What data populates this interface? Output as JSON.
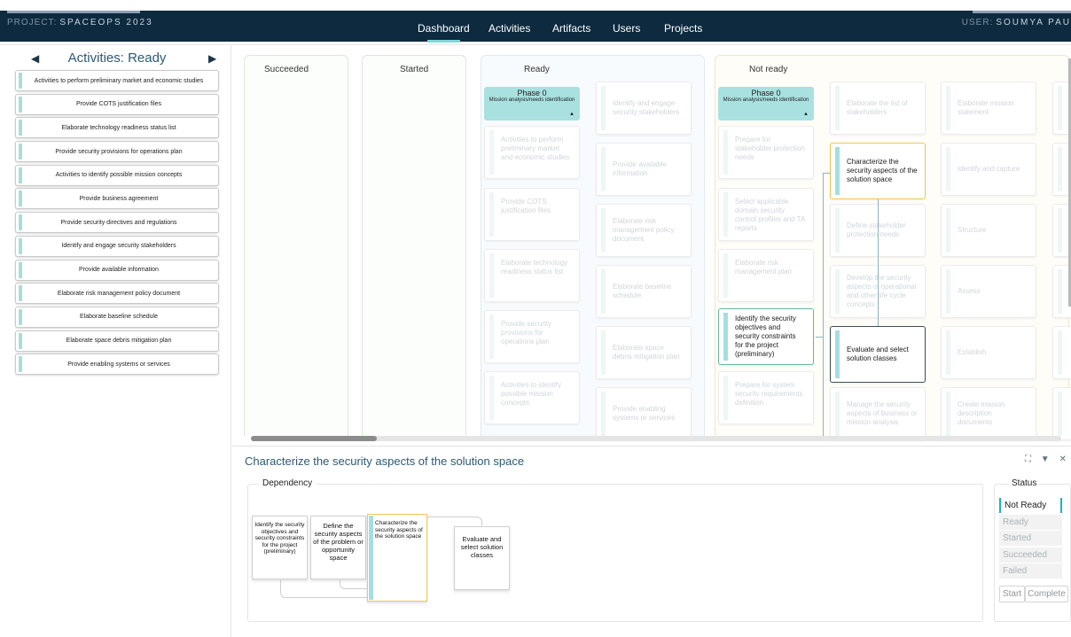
{
  "header": {
    "project_label": "PROJECT:",
    "project_name": "SPACEOPS 2023",
    "user_label": "USER:",
    "user_name": "SOUMYA PAU",
    "nav": [
      "Dashboard",
      "Activities",
      "Artifacts",
      "Users",
      "Projects"
    ]
  },
  "left_panel": {
    "title": "Activities: Ready",
    "items": [
      "Activities to perform preliminary market and economic studies",
      "Provide COTS justification files",
      "Elaborate technology readiness status list",
      "Provide security provisions for operations plan",
      "Activities to identify possible mission concepts",
      "Provide business agreement",
      "Provide security directives and regulations",
      "Identify and engage security stakeholders",
      "Provide available information",
      "Elaborate risk management policy document",
      "Elaborate baseline schedule",
      "Elaborate space debris mitigation plan",
      "Provide enabling systems or services"
    ]
  },
  "board": {
    "columns": [
      "Succeeded",
      "Started",
      "Ready",
      "Not ready"
    ],
    "ready_phase": {
      "title": "Phase 0",
      "subtitle": "Mission analysis/needs identification"
    },
    "notready_phase": {
      "title": "Phase 0",
      "subtitle": "Mission analysis/needs identification"
    },
    "ready_col1": [
      "Activities to perform preliminary market and economic studies",
      "Provide COTS justification files",
      "Elaborate technology readiness status list",
      "Provide security provisions for operations plan",
      "Activities to identify possible mission concepts"
    ],
    "ready_col2": [
      "Identify and engage security stakeholders",
      "Provide available information",
      "Elaborate risk management policy document",
      "Elaborate baseline schedule",
      "Elaborate space debris mitigation plan",
      "Provide enabling systems or services"
    ],
    "nr_col1": [
      "Prepare for stakeholder protection needs",
      "Select applicable domain security control profiles and TA reports",
      "Elaborate risk management plan",
      "Identify the security objectives and security constraints for the project (preliminary)",
      "Prepare for system security requirements definition"
    ],
    "nr_col2": [
      "Elaborate the list of stakeholders",
      "Characterize the security aspects of the solution space",
      "Define stakeholder protection needs",
      "Develop the security aspects of operational and other life cycle concepts",
      "Evaluate and select solution classes",
      "Manage the security aspects of business or mission analysis"
    ],
    "nr_col3": [
      "Elaborate mission statement",
      "Identify and capture",
      "Structure",
      "Assess",
      "Establish",
      "Create mission description documents"
    ]
  },
  "detail": {
    "title": "Characterize the security aspects of the solution space",
    "dependency_label": "Dependency",
    "dep_cards": [
      "Identify the security objectives and security constraints for the project (preliminary)",
      "Define the security aspects of the problem or opportunity space",
      "Characterize the security aspects of the solution space",
      "Evaluate and select solution classes"
    ],
    "status_label": "Status",
    "statuses": [
      "Not Ready",
      "Ready",
      "Started",
      "Succeeded",
      "Failed"
    ],
    "buttons": [
      "Start",
      "Complete"
    ]
  }
}
